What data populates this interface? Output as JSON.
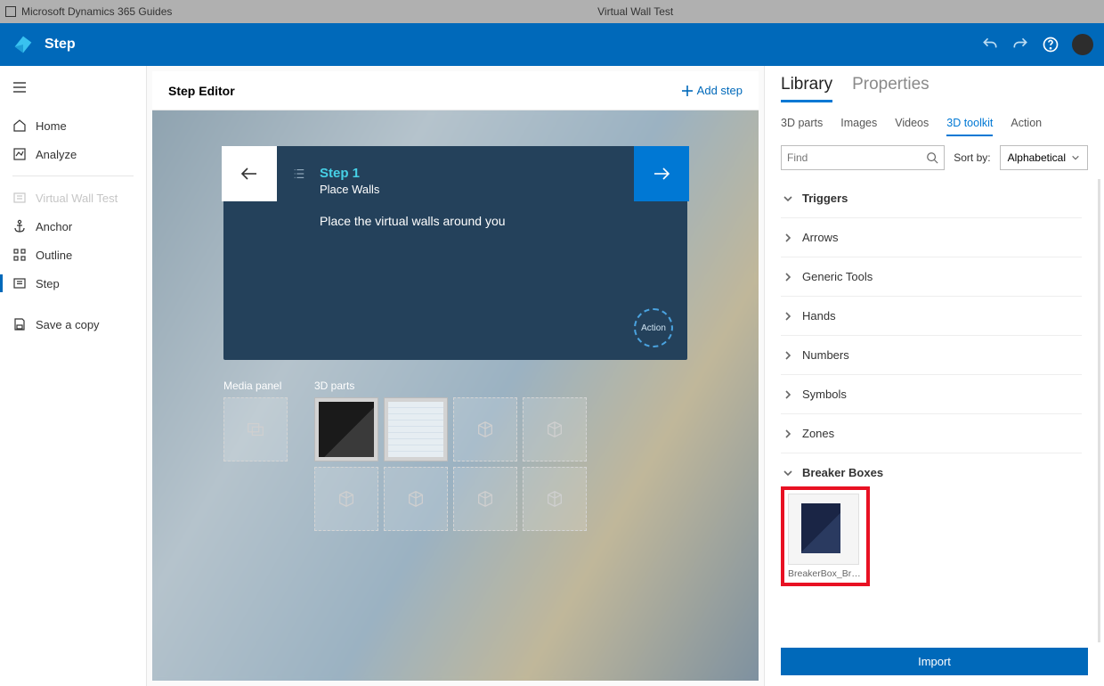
{
  "titlebar": {
    "app_name": "Microsoft Dynamics 365 Guides",
    "doc_name": "Virtual Wall Test"
  },
  "headerbar": {
    "title": "Step"
  },
  "sidebar": {
    "items": [
      {
        "key": "home",
        "label": "Home",
        "icon": "home-icon"
      },
      {
        "key": "analyze",
        "label": "Analyze",
        "icon": "analyze-icon"
      },
      {
        "key": "guide",
        "label": "Virtual Wall Test",
        "icon": "guide-icon",
        "disabled": true
      },
      {
        "key": "anchor",
        "label": "Anchor",
        "icon": "anchor-icon"
      },
      {
        "key": "outline",
        "label": "Outline",
        "icon": "outline-icon"
      },
      {
        "key": "step",
        "label": "Step",
        "icon": "step-icon",
        "selected": true
      },
      {
        "key": "save",
        "label": "Save a copy",
        "icon": "save-icon"
      }
    ]
  },
  "step_editor": {
    "title": "Step Editor",
    "add_step_label": "Add step",
    "card": {
      "step_title": "Step 1",
      "step_subtitle": "Place Walls",
      "description": "Place the virtual walls around you",
      "action_chip": "Action"
    },
    "media_panel_label": "Media panel",
    "parts_panel_label": "3D parts"
  },
  "rightpanel": {
    "tabs": {
      "library": "Library",
      "properties": "Properties",
      "active": "library"
    },
    "subtabs": [
      "3D parts",
      "Images",
      "Videos",
      "3D toolkit",
      "Action"
    ],
    "active_subtab": "3D toolkit",
    "search_placeholder": "Find",
    "sort_label": "Sort by:",
    "sort_value": "Alphabetical",
    "categories": [
      {
        "label": "Triggers",
        "expanded": true
      },
      {
        "label": "Arrows"
      },
      {
        "label": "Generic Tools"
      },
      {
        "label": "Hands"
      },
      {
        "label": "Numbers"
      },
      {
        "label": "Symbols"
      },
      {
        "label": "Zones"
      },
      {
        "label": "Breaker Boxes",
        "expanded": true,
        "items": [
          {
            "name": "BreakerBox_Breaker_...",
            "highlighted": true
          }
        ]
      }
    ],
    "import_label": "Import"
  }
}
